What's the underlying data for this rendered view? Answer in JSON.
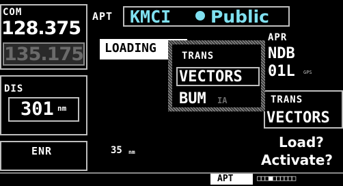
{
  "left": {
    "com_label": "COM",
    "com_active": "128.375",
    "com_standby": "135.175",
    "dis_label": "DIS",
    "dis_value": "301",
    "dis_unit": "nm",
    "mode": "ENR"
  },
  "header": {
    "apt_label": "APT",
    "airport_id": "KMCI",
    "airport_type": "Public"
  },
  "map": {
    "status": "LOADING",
    "range": "35",
    "range_unit": "nm"
  },
  "trans_popup": {
    "title": "TRANS",
    "options": [
      {
        "label": "VECTORS",
        "selected": true
      },
      {
        "label": "BUM",
        "suffix": "IA",
        "selected": false
      }
    ]
  },
  "right": {
    "apr_label": "APR",
    "apr_line1": "NDB",
    "apr_line2": "01L",
    "apr_suffix": "GPS",
    "trans_label": "TRANS",
    "trans_value": "VECTORS",
    "prompt_load": "Load?",
    "prompt_activate": "Activate?"
  },
  "footer": {
    "page_group": "APT",
    "page_indicator": "□□□■□□□□□□"
  },
  "colors": {
    "background": "#000000",
    "border": "#bfbfbf",
    "cyan": "#7fe0f0",
    "inactive": "#6a6a6a"
  }
}
